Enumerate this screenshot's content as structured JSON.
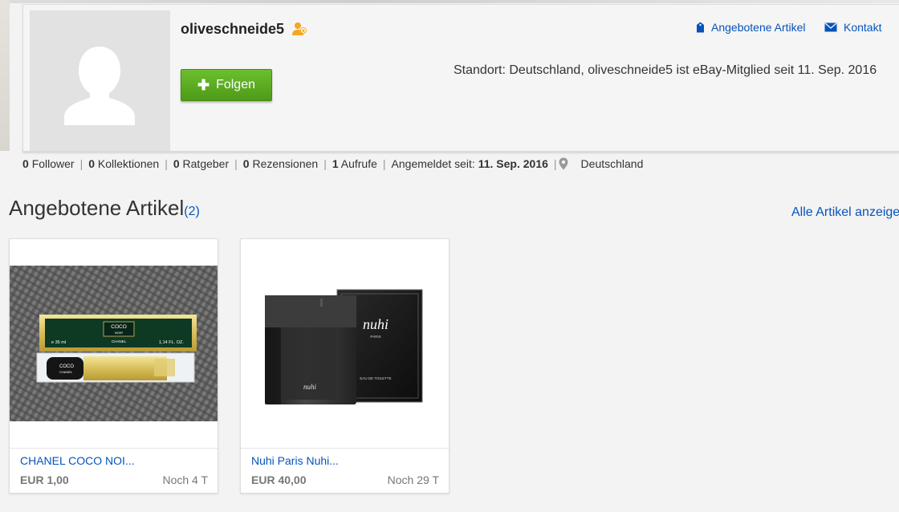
{
  "profile": {
    "username": "oliveschneide5",
    "follow_label": "Folgen",
    "links": {
      "articles": "Angebotene Artikel",
      "contact": "Kontakt"
    },
    "standort": "Standort: Deutschland, oliveschneide5 ist eBay-Mitglied seit 11. Sep. 2016"
  },
  "stats": {
    "follower_count": "0",
    "follower_label": "Follower",
    "collections_count": "0",
    "collections_label": "Kollektionen",
    "guides_count": "0",
    "guides_label": "Ratgeber",
    "reviews_count": "0",
    "reviews_label": "Rezensionen",
    "views_count": "1",
    "views_label": "Aufrufe",
    "registered_label": "Angemeldet seit:",
    "registered_date": "11. Sep. 2016",
    "location": "Deutschland"
  },
  "section": {
    "title": "Angebotene Artikel",
    "count": "(2)",
    "all_link": "Alle Artikel anzeige"
  },
  "items": [
    {
      "title": "CHANEL COCO NOI...",
      "price": "EUR 1,00",
      "time_left": "Noch 4 T",
      "box_brand": "COCO",
      "box_sub": "NOIR",
      "box_vol_left": "e 35 ml",
      "box_vol_right": "1,14 FL. OZ.",
      "box_maker": "CHANEL",
      "bottle_label": "COCO",
      "bottle_maker": "CHANEL"
    },
    {
      "title": "Nuhi Paris Nuhi...",
      "price": "EUR 40,00",
      "time_left": "Noch 29 T",
      "box_brand": "nuhi",
      "box_sub": "PARIS",
      "box_edt": "EAU DE TOILETTE",
      "bottle_label": "nuhi"
    }
  ],
  "colors": {
    "link": "#0654ba",
    "follow_button": "#5aa820",
    "badge": "#f5a623"
  },
  "icons": {
    "badge": "user-star-icon",
    "articles": "tag-icon",
    "contact": "envelope-icon",
    "location": "location-pin-icon",
    "follow": "plus-icon"
  }
}
